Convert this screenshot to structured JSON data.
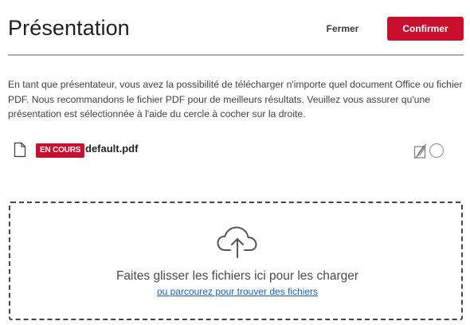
{
  "header": {
    "title": "Présentation",
    "close_label": "Fermer",
    "confirm_label": "Confirmer"
  },
  "description": "En tant que présentateur, vous avez la possibilité de télécharger n'importe quel document Office ou fichier PDF. Nous recommandons le fichier PDF pour de meilleurs résultats. Veuillez vous assurer qu'une présentation est sélectionnée à l'aide du cercle à cocher sur la droite.",
  "files": [
    {
      "icon": "file-icon",
      "status_badge": "EN COURS",
      "name": "default.pdf",
      "actions": [
        "edit-disabled-icon",
        "select-radio"
      ]
    }
  ],
  "dropzone": {
    "icon": "cloud-upload-icon",
    "text": "Faites glisser les fichiers ici pour les charger",
    "browse_link": "ou parcourez pour trouver des fichiers"
  },
  "colors": {
    "accent": "#c8102e",
    "link": "#1a5fb4",
    "divider": "#a9adb3"
  }
}
